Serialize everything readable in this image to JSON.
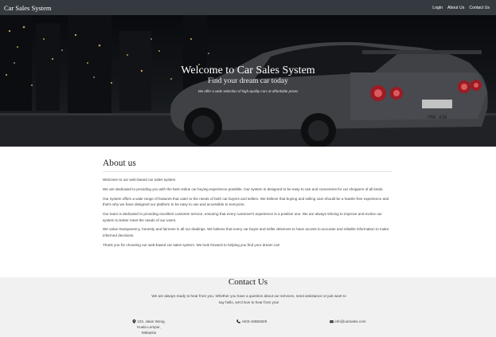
{
  "nav": {
    "brand": "Car Sales System",
    "links": [
      "Login",
      "About Us",
      "Contact Us"
    ]
  },
  "hero": {
    "title": "Welcome to Car Sales System",
    "subtitle": "Find your dream car today",
    "tagline": "We offer a wide selection of high-quality cars at affordable prices",
    "plate": "YMA 438"
  },
  "about": {
    "heading": "About us",
    "paragraphs": [
      "Welcome to our web-based car sales system.",
      "We are dedicated to providing you with the best online car buying experience possible. Our system is designed to be easy to use and convenient for car shoppers of all kinds.",
      "Our system offers a wide range of features that cater to the needs of both car buyers and sellers. We believe that buying and selling cars should be a hassle-free experience and that's why we have designed our platform to be easy to use and accessible to everyone.",
      "Our team is dedicated to providing excellent customer service, ensuring that every customer's experience is a positive one. We are always striving to improve and evolve our system to better meet the needs of our users.",
      "We value transparency, honesty and fairness in all our dealings. We believe that every car buyer and seller deserves to have access to accurate and reliable information to make informed decisions.",
      "Thank you for choosing our web-based car sales system. We look forward to helping you find your dream car!"
    ]
  },
  "contact": {
    "heading": "Contact Us",
    "intro": "We are always ready to hear from you. Whether you have a question about our services, need assistance or just want to say hello, we'd love to hear from you!",
    "address": [
      "123, Jalan Wong,",
      "Kuala Lumpur,",
      "Malaysia"
    ],
    "phone": "+603-16882829",
    "email": "info@carsales.com",
    "icons": [
      "map-marker-icon",
      "phone-icon",
      "envelope-icon"
    ]
  }
}
